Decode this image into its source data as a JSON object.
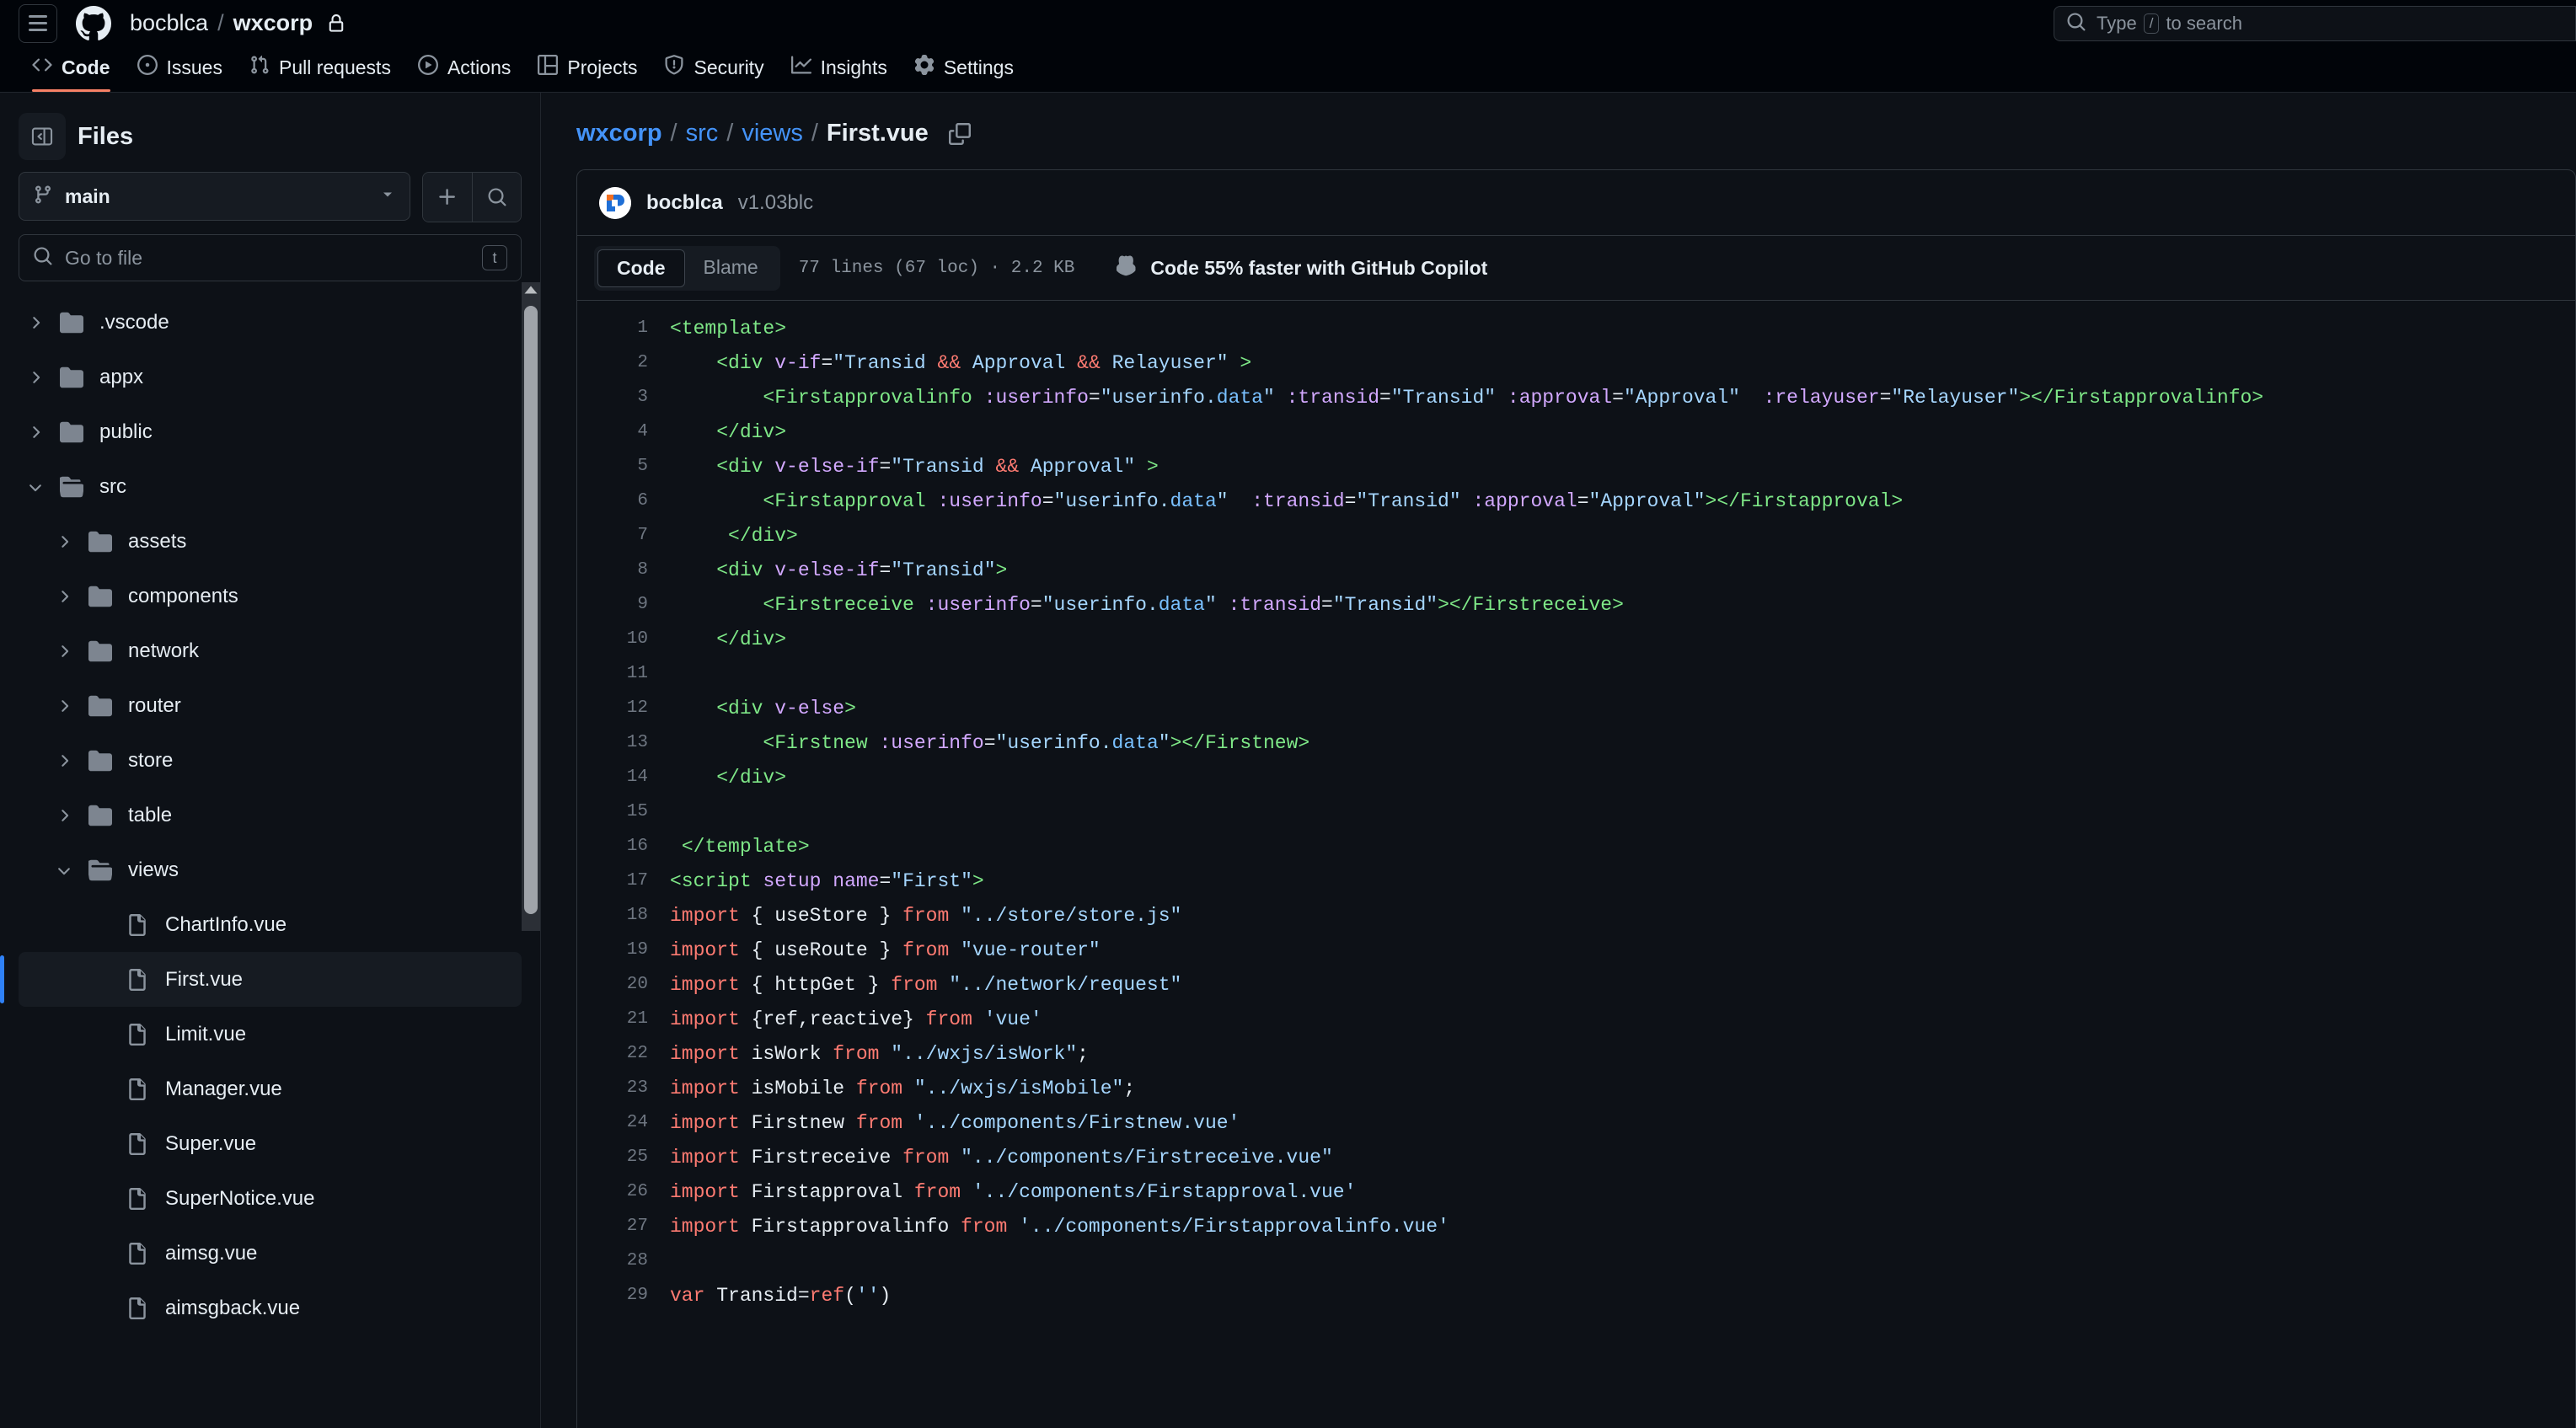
{
  "header": {
    "owner": "bocblca",
    "separator": "/",
    "repo": "wxcorp",
    "search_placeholder": "Type",
    "search_kbd": "/",
    "search_suffix": "to search"
  },
  "nav": {
    "tabs": [
      {
        "label": "Code",
        "icon": "code-icon",
        "selected": true
      },
      {
        "label": "Issues",
        "icon": "issue-icon",
        "selected": false
      },
      {
        "label": "Pull requests",
        "icon": "pull-request-icon",
        "selected": false
      },
      {
        "label": "Actions",
        "icon": "play-icon",
        "selected": false
      },
      {
        "label": "Projects",
        "icon": "table-icon",
        "selected": false
      },
      {
        "label": "Security",
        "icon": "shield-icon",
        "selected": false
      },
      {
        "label": "Insights",
        "icon": "graph-icon",
        "selected": false
      },
      {
        "label": "Settings",
        "icon": "gear-icon",
        "selected": false
      }
    ]
  },
  "sidebar": {
    "title": "Files",
    "branch": "main",
    "gotofile_placeholder": "Go to file",
    "gotofile_kbd": "t",
    "tree": [
      {
        "label": ".vscode",
        "type": "folder-closed",
        "depth": 1,
        "expanded": false,
        "selected": false
      },
      {
        "label": "appx",
        "type": "folder-closed",
        "depth": 1,
        "expanded": false,
        "selected": false
      },
      {
        "label": "public",
        "type": "folder-closed",
        "depth": 1,
        "expanded": false,
        "selected": false
      },
      {
        "label": "src",
        "type": "folder-open",
        "depth": 1,
        "expanded": true,
        "selected": false
      },
      {
        "label": "assets",
        "type": "folder-closed",
        "depth": 2,
        "expanded": false,
        "selected": false
      },
      {
        "label": "components",
        "type": "folder-closed",
        "depth": 2,
        "expanded": false,
        "selected": false
      },
      {
        "label": "network",
        "type": "folder-closed",
        "depth": 2,
        "expanded": false,
        "selected": false
      },
      {
        "label": "router",
        "type": "folder-closed",
        "depth": 2,
        "expanded": false,
        "selected": false
      },
      {
        "label": "store",
        "type": "folder-closed",
        "depth": 2,
        "expanded": false,
        "selected": false
      },
      {
        "label": "table",
        "type": "folder-closed",
        "depth": 2,
        "expanded": false,
        "selected": false
      },
      {
        "label": "views",
        "type": "folder-open",
        "depth": 2,
        "expanded": true,
        "selected": false
      },
      {
        "label": "ChartInfo.vue",
        "type": "file",
        "depth": 3,
        "selected": false
      },
      {
        "label": "First.vue",
        "type": "file",
        "depth": 3,
        "selected": true
      },
      {
        "label": "Limit.vue",
        "type": "file",
        "depth": 3,
        "selected": false
      },
      {
        "label": "Manager.vue",
        "type": "file",
        "depth": 3,
        "selected": false
      },
      {
        "label": "Super.vue",
        "type": "file",
        "depth": 3,
        "selected": false
      },
      {
        "label": "SuperNotice.vue",
        "type": "file",
        "depth": 3,
        "selected": false
      },
      {
        "label": "aimsg.vue",
        "type": "file",
        "depth": 3,
        "selected": false
      },
      {
        "label": "aimsgback.vue",
        "type": "file",
        "depth": 3,
        "selected": false
      }
    ]
  },
  "main": {
    "breadcrumb": [
      {
        "label": "wxcorp",
        "link": true,
        "bold": true
      },
      {
        "label": "src",
        "link": true,
        "bold": false
      },
      {
        "label": "views",
        "link": true,
        "bold": false
      },
      {
        "label": "First.vue",
        "link": false,
        "bold": true
      }
    ],
    "breadcrumb_separator": "/",
    "commit": {
      "author": "bocblca",
      "message": "v1.03blc"
    },
    "tabs": [
      {
        "label": "Code",
        "active": true
      },
      {
        "label": "Blame",
        "active": false
      }
    ],
    "file_meta": "77 lines (67 loc) · 2.2 KB",
    "copilot_cta": "Code 55% faster with GitHub Copilot",
    "code_lines": [
      {
        "n": 1,
        "tokens": [
          {
            "t": "tag",
            "v": "<template>"
          }
        ]
      },
      {
        "n": 2,
        "tokens": [
          {
            "t": "plain",
            "v": "    "
          },
          {
            "t": "tag",
            "v": "<div"
          },
          {
            "t": "plain",
            "v": " "
          },
          {
            "t": "attr",
            "v": "v-if"
          },
          {
            "t": "plain",
            "v": "="
          },
          {
            "t": "str",
            "v": "\"Transid "
          },
          {
            "t": "op",
            "v": "&&"
          },
          {
            "t": "str",
            "v": " Approval "
          },
          {
            "t": "op",
            "v": "&&"
          },
          {
            "t": "str",
            "v": " Relayuser\""
          },
          {
            "t": "plain",
            "v": " "
          },
          {
            "t": "tag",
            "v": ">"
          }
        ]
      },
      {
        "n": 3,
        "tokens": [
          {
            "t": "plain",
            "v": "        "
          },
          {
            "t": "tag",
            "v": "<Firstapprovalinfo"
          },
          {
            "t": "plain",
            "v": " "
          },
          {
            "t": "attr",
            "v": ":userinfo"
          },
          {
            "t": "plain",
            "v": "="
          },
          {
            "t": "str",
            "v": "\"userinfo."
          },
          {
            "t": "prop",
            "v": "data"
          },
          {
            "t": "str",
            "v": "\""
          },
          {
            "t": "plain",
            "v": " "
          },
          {
            "t": "attr",
            "v": ":transid"
          },
          {
            "t": "plain",
            "v": "="
          },
          {
            "t": "str",
            "v": "\"Transid\""
          },
          {
            "t": "plain",
            "v": " "
          },
          {
            "t": "attr",
            "v": ":approval"
          },
          {
            "t": "plain",
            "v": "="
          },
          {
            "t": "str",
            "v": "\"Approval\""
          },
          {
            "t": "plain",
            "v": "  "
          },
          {
            "t": "attr",
            "v": ":relayuser"
          },
          {
            "t": "plain",
            "v": "="
          },
          {
            "t": "str",
            "v": "\"Relayuser\""
          },
          {
            "t": "tag",
            "v": "></Firstapprovalinfo>"
          }
        ]
      },
      {
        "n": 4,
        "tokens": [
          {
            "t": "plain",
            "v": "    "
          },
          {
            "t": "tag",
            "v": "</div>"
          }
        ]
      },
      {
        "n": 5,
        "tokens": [
          {
            "t": "plain",
            "v": "    "
          },
          {
            "t": "tag",
            "v": "<div"
          },
          {
            "t": "plain",
            "v": " "
          },
          {
            "t": "attr",
            "v": "v-else-if"
          },
          {
            "t": "plain",
            "v": "="
          },
          {
            "t": "str",
            "v": "\"Transid "
          },
          {
            "t": "op",
            "v": "&&"
          },
          {
            "t": "str",
            "v": " Approval\""
          },
          {
            "t": "plain",
            "v": " "
          },
          {
            "t": "tag",
            "v": ">"
          }
        ]
      },
      {
        "n": 6,
        "tokens": [
          {
            "t": "plain",
            "v": "        "
          },
          {
            "t": "tag",
            "v": "<Firstapproval"
          },
          {
            "t": "plain",
            "v": " "
          },
          {
            "t": "attr",
            "v": ":userinfo"
          },
          {
            "t": "plain",
            "v": "="
          },
          {
            "t": "str",
            "v": "\"userinfo."
          },
          {
            "t": "prop",
            "v": "data"
          },
          {
            "t": "str",
            "v": "\""
          },
          {
            "t": "plain",
            "v": "  "
          },
          {
            "t": "attr",
            "v": ":transid"
          },
          {
            "t": "plain",
            "v": "="
          },
          {
            "t": "str",
            "v": "\"Transid\""
          },
          {
            "t": "plain",
            "v": " "
          },
          {
            "t": "attr",
            "v": ":approval"
          },
          {
            "t": "plain",
            "v": "="
          },
          {
            "t": "str",
            "v": "\"Approval\""
          },
          {
            "t": "tag",
            "v": "></Firstapproval>"
          }
        ]
      },
      {
        "n": 7,
        "tokens": [
          {
            "t": "plain",
            "v": "     "
          },
          {
            "t": "tag",
            "v": "</div>"
          }
        ]
      },
      {
        "n": 8,
        "tokens": [
          {
            "t": "plain",
            "v": "    "
          },
          {
            "t": "tag",
            "v": "<div"
          },
          {
            "t": "plain",
            "v": " "
          },
          {
            "t": "attr",
            "v": "v-else-if"
          },
          {
            "t": "plain",
            "v": "="
          },
          {
            "t": "str",
            "v": "\"Transid\""
          },
          {
            "t": "tag",
            "v": ">"
          }
        ]
      },
      {
        "n": 9,
        "tokens": [
          {
            "t": "plain",
            "v": "        "
          },
          {
            "t": "tag",
            "v": "<Firstreceive"
          },
          {
            "t": "plain",
            "v": " "
          },
          {
            "t": "attr",
            "v": ":userinfo"
          },
          {
            "t": "plain",
            "v": "="
          },
          {
            "t": "str",
            "v": "\"userinfo."
          },
          {
            "t": "prop",
            "v": "data"
          },
          {
            "t": "str",
            "v": "\""
          },
          {
            "t": "plain",
            "v": " "
          },
          {
            "t": "attr",
            "v": ":transid"
          },
          {
            "t": "plain",
            "v": "="
          },
          {
            "t": "str",
            "v": "\"Transid\""
          },
          {
            "t": "tag",
            "v": "></Firstreceive>"
          }
        ]
      },
      {
        "n": 10,
        "tokens": [
          {
            "t": "plain",
            "v": "    "
          },
          {
            "t": "tag",
            "v": "</div>"
          }
        ]
      },
      {
        "n": 11,
        "tokens": []
      },
      {
        "n": 12,
        "tokens": [
          {
            "t": "plain",
            "v": "    "
          },
          {
            "t": "tag",
            "v": "<div"
          },
          {
            "t": "plain",
            "v": " "
          },
          {
            "t": "attr",
            "v": "v-else"
          },
          {
            "t": "tag",
            "v": ">"
          }
        ]
      },
      {
        "n": 13,
        "tokens": [
          {
            "t": "plain",
            "v": "        "
          },
          {
            "t": "tag",
            "v": "<Firstnew"
          },
          {
            "t": "plain",
            "v": " "
          },
          {
            "t": "attr",
            "v": ":userinfo"
          },
          {
            "t": "plain",
            "v": "="
          },
          {
            "t": "str",
            "v": "\"userinfo."
          },
          {
            "t": "prop",
            "v": "data"
          },
          {
            "t": "str",
            "v": "\""
          },
          {
            "t": "tag",
            "v": "></Firstnew>"
          }
        ]
      },
      {
        "n": 14,
        "tokens": [
          {
            "t": "plain",
            "v": "    "
          },
          {
            "t": "tag",
            "v": "</div>"
          }
        ]
      },
      {
        "n": 15,
        "tokens": []
      },
      {
        "n": 16,
        "tokens": [
          {
            "t": "plain",
            "v": " "
          },
          {
            "t": "tag",
            "v": "</template>"
          }
        ]
      },
      {
        "n": 17,
        "tokens": [
          {
            "t": "tag",
            "v": "<script"
          },
          {
            "t": "plain",
            "v": " "
          },
          {
            "t": "attr",
            "v": "setup"
          },
          {
            "t": "plain",
            "v": " "
          },
          {
            "t": "attr",
            "v": "name"
          },
          {
            "t": "plain",
            "v": "="
          },
          {
            "t": "str",
            "v": "\"First\""
          },
          {
            "t": "tag",
            "v": ">"
          }
        ]
      },
      {
        "n": 18,
        "tokens": [
          {
            "t": "kw",
            "v": "import"
          },
          {
            "t": "plain",
            "v": " { useStore } "
          },
          {
            "t": "kw",
            "v": "from"
          },
          {
            "t": "plain",
            "v": " "
          },
          {
            "t": "str",
            "v": "\"../store/store.js\""
          }
        ]
      },
      {
        "n": 19,
        "tokens": [
          {
            "t": "kw",
            "v": "import"
          },
          {
            "t": "plain",
            "v": " { useRoute } "
          },
          {
            "t": "kw",
            "v": "from"
          },
          {
            "t": "plain",
            "v": " "
          },
          {
            "t": "str",
            "v": "\"vue-router\""
          }
        ]
      },
      {
        "n": 20,
        "tokens": [
          {
            "t": "kw",
            "v": "import"
          },
          {
            "t": "plain",
            "v": " { httpGet } "
          },
          {
            "t": "kw",
            "v": "from"
          },
          {
            "t": "plain",
            "v": " "
          },
          {
            "t": "str",
            "v": "\"../network/request\""
          }
        ]
      },
      {
        "n": 21,
        "tokens": [
          {
            "t": "kw",
            "v": "import"
          },
          {
            "t": "plain",
            "v": " {ref,reactive} "
          },
          {
            "t": "kw",
            "v": "from"
          },
          {
            "t": "plain",
            "v": " "
          },
          {
            "t": "str",
            "v": "'vue'"
          }
        ]
      },
      {
        "n": 22,
        "tokens": [
          {
            "t": "kw",
            "v": "import"
          },
          {
            "t": "plain",
            "v": " isWork "
          },
          {
            "t": "kw",
            "v": "from"
          },
          {
            "t": "plain",
            "v": " "
          },
          {
            "t": "str",
            "v": "\"../wxjs/isWork\""
          },
          {
            "t": "plain",
            "v": ";"
          }
        ]
      },
      {
        "n": 23,
        "tokens": [
          {
            "t": "kw",
            "v": "import"
          },
          {
            "t": "plain",
            "v": " isMobile "
          },
          {
            "t": "kw",
            "v": "from"
          },
          {
            "t": "plain",
            "v": " "
          },
          {
            "t": "str",
            "v": "\"../wxjs/isMobile\""
          },
          {
            "t": "plain",
            "v": ";"
          }
        ]
      },
      {
        "n": 24,
        "tokens": [
          {
            "t": "kw",
            "v": "import"
          },
          {
            "t": "plain",
            "v": " Firstnew "
          },
          {
            "t": "kw",
            "v": "from"
          },
          {
            "t": "plain",
            "v": " "
          },
          {
            "t": "str",
            "v": "'../components/Firstnew.vue'"
          }
        ]
      },
      {
        "n": 25,
        "tokens": [
          {
            "t": "kw",
            "v": "import"
          },
          {
            "t": "plain",
            "v": " Firstreceive "
          },
          {
            "t": "kw",
            "v": "from"
          },
          {
            "t": "plain",
            "v": " "
          },
          {
            "t": "str",
            "v": "\"../components/Firstreceive.vue\""
          }
        ]
      },
      {
        "n": 26,
        "tokens": [
          {
            "t": "kw",
            "v": "import"
          },
          {
            "t": "plain",
            "v": " Firstapproval "
          },
          {
            "t": "kw",
            "v": "from"
          },
          {
            "t": "plain",
            "v": " "
          },
          {
            "t": "str",
            "v": "'../components/Firstapproval.vue'"
          }
        ]
      },
      {
        "n": 27,
        "tokens": [
          {
            "t": "kw",
            "v": "import"
          },
          {
            "t": "plain",
            "v": " Firstapprovalinfo "
          },
          {
            "t": "kw",
            "v": "from"
          },
          {
            "t": "plain",
            "v": " "
          },
          {
            "t": "str",
            "v": "'../components/Firstapprovalinfo.vue'"
          }
        ]
      },
      {
        "n": 28,
        "tokens": []
      },
      {
        "n": 29,
        "tokens": [
          {
            "t": "kw",
            "v": "var"
          },
          {
            "t": "plain",
            "v": " Transid="
          },
          {
            "t": "kw",
            "v": "ref"
          },
          {
            "t": "plain",
            "v": "("
          },
          {
            "t": "str",
            "v": "''"
          },
          {
            "t": "plain",
            "v": ")"
          }
        ]
      }
    ]
  },
  "colors": {
    "accent": "#2f81f7",
    "link": "#4493f8",
    "tab_underline": "#f78166",
    "bg": "#0d1117",
    "header_bg": "#010409",
    "border": "#30363d",
    "muted": "#8b949e"
  }
}
